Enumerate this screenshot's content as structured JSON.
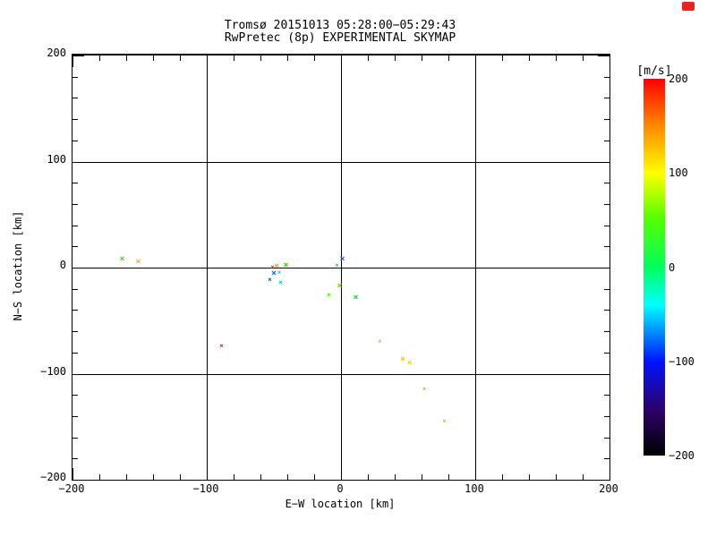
{
  "window": {
    "corner_mark_color": "#f02020"
  },
  "chart_data": {
    "type": "scatter",
    "title": "Tromsø 20151013 05:28:00−05:29:43",
    "subtitle": "RwPretec (8p) EXPERIMENTAL SKYMAP",
    "xlabel": "E−W location [km]",
    "ylabel": "N−S location [km]",
    "xlim": [
      -200,
      200
    ],
    "ylim": [
      -200,
      200
    ],
    "xticks": [
      -200,
      -100,
      0,
      100,
      200
    ],
    "xtick_labels": [
      "−200",
      "−100",
      "0",
      "100",
      "200"
    ],
    "yticks": [
      -200,
      -100,
      0,
      100,
      200
    ],
    "ytick_labels": [
      "−200",
      "−100",
      "0",
      "100",
      "200"
    ],
    "minor_tick_step": 20,
    "grid": true,
    "marker": "x",
    "colorbar": {
      "label": "[m/s]",
      "min": -200,
      "max": 200,
      "ticks": [
        200,
        100,
        0,
        -100,
        -200
      ],
      "tick_labels": [
        "200",
        "100",
        "0",
        "−100",
        "−200"
      ],
      "gradient_stops": [
        {
          "value": -200,
          "color": "#000000"
        },
        {
          "value": -152,
          "color": "#2e0068"
        },
        {
          "value": -100,
          "color": "#0013ff"
        },
        {
          "value": -40,
          "color": "#00ffff"
        },
        {
          "value": 0,
          "color": "#00ff5e"
        },
        {
          "value": 52,
          "color": "#55ff00"
        },
        {
          "value": 100,
          "color": "#ffff00"
        },
        {
          "value": 152,
          "color": "#ff8400"
        },
        {
          "value": 200,
          "color": "#ff0000"
        }
      ]
    },
    "points": [
      {
        "x": -163,
        "y": 8,
        "v": 60,
        "color": "#55cc22",
        "size": "m"
      },
      {
        "x": -151,
        "y": 5,
        "v": 140,
        "color": "#ffaa22",
        "size": "m"
      },
      {
        "x": -51,
        "y": 0,
        "v": 195,
        "color": "#ee2200",
        "size": "s"
      },
      {
        "x": -48,
        "y": 1,
        "v": 150,
        "color": "#ff9900",
        "size": "m"
      },
      {
        "x": -41,
        "y": 2,
        "v": 55,
        "color": "#33cc00",
        "size": "m"
      },
      {
        "x": -50,
        "y": -6,
        "v": -85,
        "color": "#0066ff",
        "size": "m"
      },
      {
        "x": -46,
        "y": -5,
        "v": -45,
        "color": "#00bbee",
        "size": "s"
      },
      {
        "x": -53,
        "y": -12,
        "v": -110,
        "color": "#0033cc",
        "size": "s"
      },
      {
        "x": -45,
        "y": -14,
        "v": -10,
        "color": "#00dd88",
        "size": "s"
      },
      {
        "x": 1,
        "y": 8,
        "v": -95,
        "color": "#2255ee",
        "size": "m"
      },
      {
        "x": -3,
        "y": 2,
        "v": -5,
        "color": "#00cc66",
        "size": "s"
      },
      {
        "x": -1,
        "y": -18,
        "v": 65,
        "color": "#66dd00",
        "size": "m"
      },
      {
        "x": -9,
        "y": -26,
        "v": 60,
        "color": "#44dd00",
        "size": "s"
      },
      {
        "x": 11,
        "y": -29,
        "v": 50,
        "color": "#33cc33",
        "size": "m"
      },
      {
        "x": -89,
        "y": -74,
        "v": 195,
        "color": "#ee0000",
        "size": "s"
      },
      {
        "x": 29,
        "y": -70,
        "v": 140,
        "color": "#ffaa00",
        "size": "s"
      },
      {
        "x": 46,
        "y": -87,
        "v": 120,
        "color": "#ffc400",
        "size": "m"
      },
      {
        "x": 51,
        "y": -90,
        "v": 110,
        "color": "#ffd800",
        "size": "m"
      },
      {
        "x": 62,
        "y": -115,
        "v": 140,
        "color": "#ffa500",
        "size": "s"
      },
      {
        "x": 77,
        "y": -145,
        "v": 140,
        "color": "#ffa500",
        "size": "s"
      }
    ]
  }
}
